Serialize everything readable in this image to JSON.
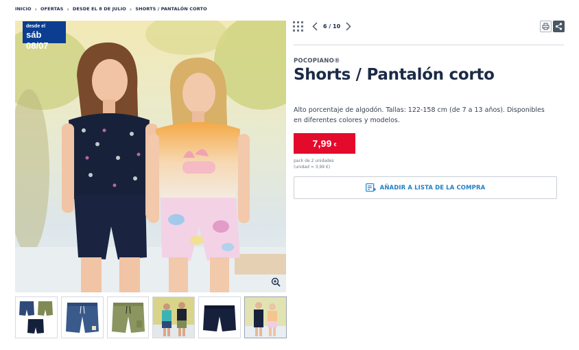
{
  "breadcrumb": {
    "items": [
      "INICIO",
      "OFERTAS",
      "DESDE EL 8 DE JULIO",
      "SHORTS / PANTALÓN CORTO"
    ]
  },
  "badge": {
    "line1": "desde el",
    "line2": "sáb 08/07"
  },
  "gallery": {
    "main_image": "two-girls-wearing-shorts-photo",
    "thumbnails": [
      {
        "name": "three-shorts-set",
        "active": false
      },
      {
        "name": "navy-drawstring-shorts",
        "active": false
      },
      {
        "name": "khaki-shorts",
        "active": false
      },
      {
        "name": "two-boys-in-shorts",
        "active": false
      },
      {
        "name": "dark-navy-shorts",
        "active": false
      },
      {
        "name": "two-girls-in-shorts",
        "active": true
      }
    ]
  },
  "pager": {
    "current": "6",
    "separator": "/",
    "total": "10",
    "display": "6 / 10"
  },
  "product": {
    "brand": "POCOPIANO®",
    "title": "Shorts / Pantalón corto",
    "description": "Alto porcentaje de algodón. Tallas: 122-158 cm (de 7 a 13 años). Disponibles en diferentes colores y modelos.",
    "price": "7,99",
    "currency": "€",
    "pack_line1": "pack de 2 unidades",
    "pack_line2": "(unidad = 3,99 €)"
  },
  "actions": {
    "add_to_list": "AÑADIR A LISTA DE LA COMPRA"
  },
  "colors": {
    "brand_blue": "#0b3d91",
    "price_red": "#e30a2b",
    "link_blue": "#1e7fc4",
    "text_dark": "#1b2a47"
  }
}
